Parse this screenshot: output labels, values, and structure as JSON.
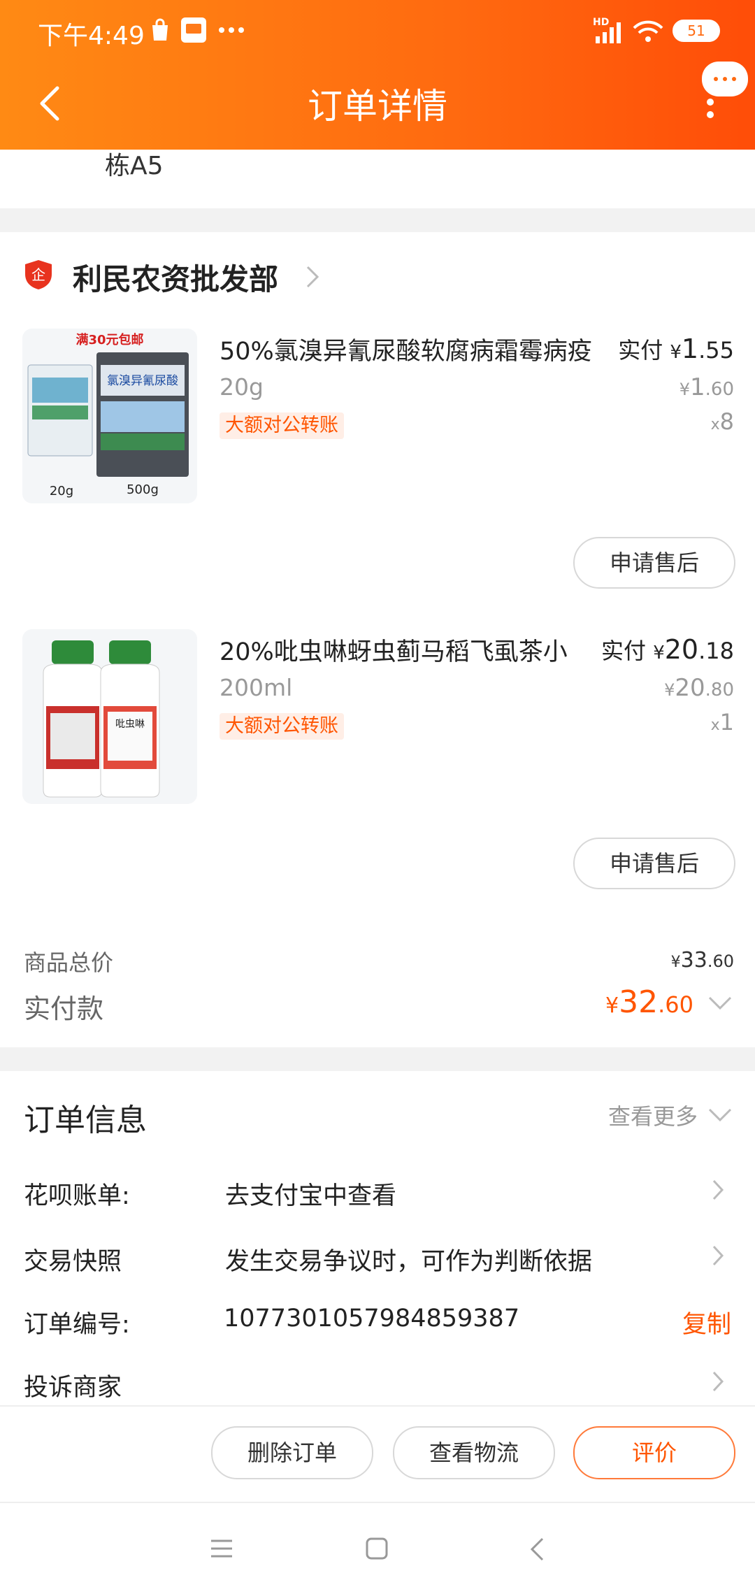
{
  "status_bar": {
    "time": "下午4:49",
    "battery": "51",
    "network": "HD"
  },
  "header": {
    "title": "订单详情"
  },
  "address": {
    "tail": "栋A5"
  },
  "shop": {
    "badge": "企",
    "name": "利民农资批发部"
  },
  "products": [
    {
      "title": "50%氯溴异氰尿酸软腐病霜霉病疫",
      "spec": "20g",
      "tag": "大额对公转账",
      "paid_label": "实付",
      "paid_int": "1",
      "paid_dec": ".55",
      "orig_int": "1",
      "orig_dec": ".60",
      "qty": "8",
      "after_sale": "申请售后",
      "image_caption": "满30元包邮",
      "image_labels": [
        "20g",
        "500g"
      ],
      "image_pack_text": "氯溴异氰尿酸"
    },
    {
      "title": "20%吡虫啉蚜虫蓟马稻飞虱茶小",
      "spec": "200ml",
      "tag": "大额对公转账",
      "paid_label": "实付",
      "paid_int": "20",
      "paid_dec": ".18",
      "orig_int": "20",
      "orig_dec": ".80",
      "qty": "1",
      "after_sale": "申请售后",
      "image_pack_text": "吡虫啉"
    }
  ],
  "currency": "¥",
  "qty_prefix": "x",
  "totals": {
    "subtotal_label": "商品总价",
    "subtotal_int": "33",
    "subtotal_dec": ".60",
    "paid_label": "实付款",
    "paid_int": "32",
    "paid_dec": ".60"
  },
  "order_info": {
    "title": "订单信息",
    "more": "查看更多",
    "rows": [
      {
        "key": "花呗账单:",
        "value": "去支付宝中查看"
      },
      {
        "key": "交易快照",
        "value": "发生交易争议时，可作为判断依据"
      },
      {
        "key": "订单编号:",
        "value": "1077301057984859387",
        "action": "复制"
      },
      {
        "key": "投诉商家",
        "value": ""
      }
    ]
  },
  "bottom_actions": {
    "delete": "删除订单",
    "logistics": "查看物流",
    "review": "评价"
  },
  "colors": {
    "accent": "#ff5500",
    "header_start": "#ff8a14",
    "header_end": "#ff4d08"
  }
}
